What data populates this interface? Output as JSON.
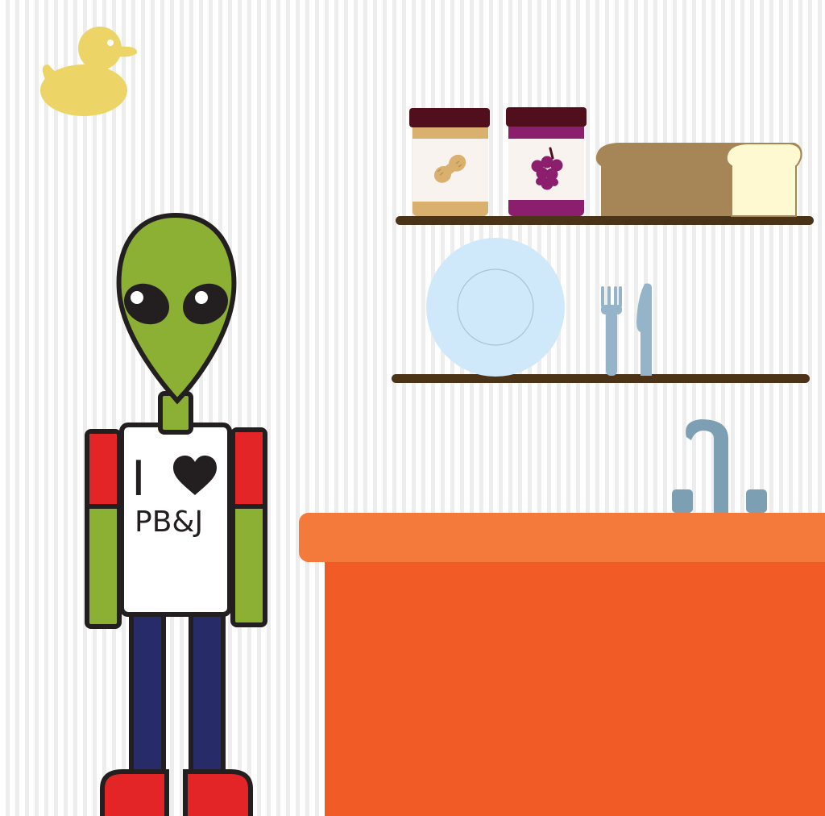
{
  "scene": {
    "shirt_text": {
      "line1": "I",
      "line2": "PB&J"
    }
  },
  "colors": {
    "wall_stripe": "#ededed",
    "alien_skin": "#8bb033",
    "outline": "#231f20",
    "sleeve_red": "#e42527",
    "pants_navy": "#272c68",
    "counter_top": "#f47a3c",
    "counter_front": "#f15b25",
    "shelf": "#4b3318",
    "duck": "#ecd466",
    "plate": "#cfe9fb",
    "cutlery": "#95b4c9",
    "faucet": "#7d9fb3",
    "bread_crust": "#a68656",
    "bread_slice": "#fff9d2",
    "jar_lid": "#510f1d",
    "peanut_butter": "#d9b06d",
    "jelly": "#8b1f6e"
  },
  "icons": [
    "duck-icon",
    "peanut-icon",
    "grapes-icon",
    "heart-icon",
    "fork-icon",
    "knife-icon",
    "faucet-icon"
  ]
}
